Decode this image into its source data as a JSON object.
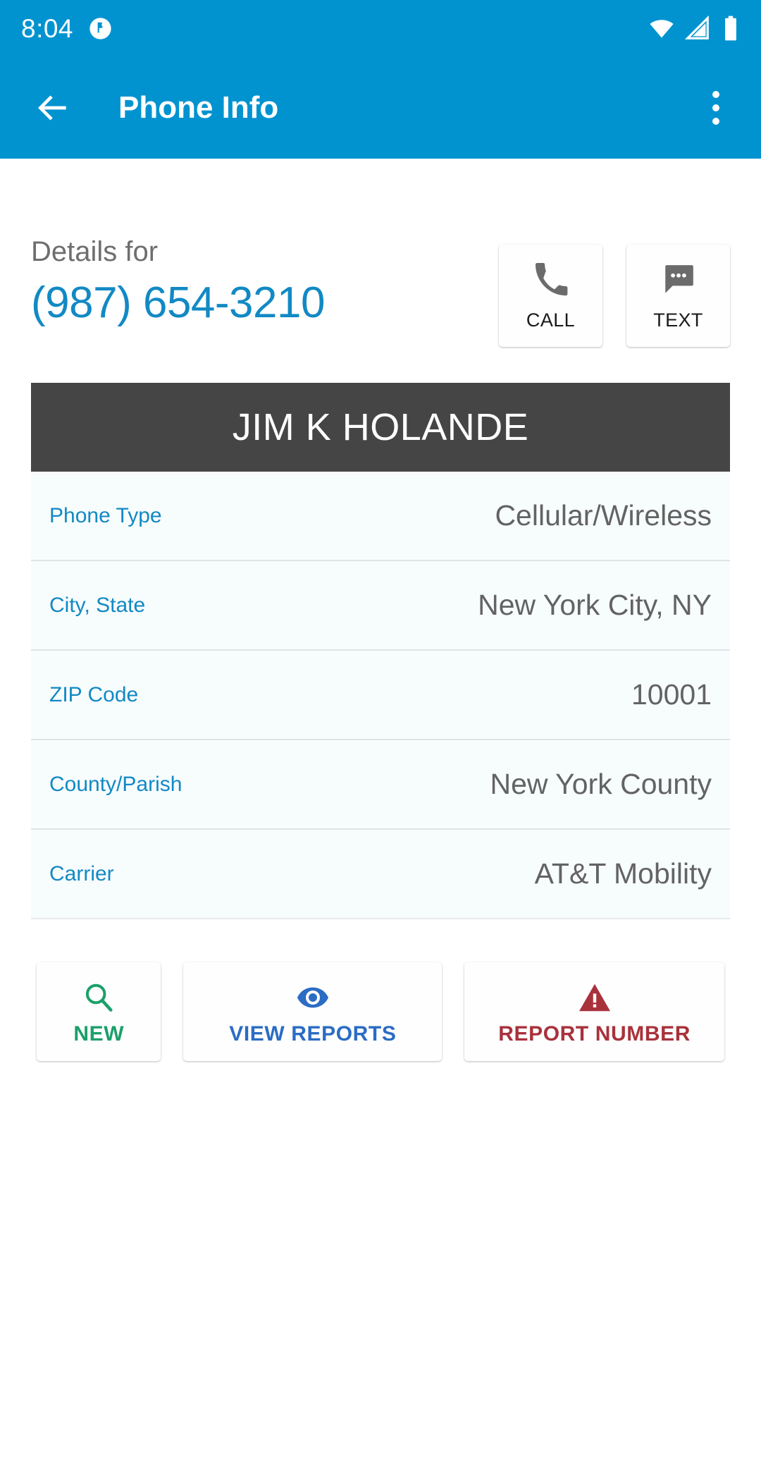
{
  "status_bar": {
    "time": "8:04",
    "notification_icon": "app-notification-icon",
    "wifi_icon": "wifi-icon",
    "signal_icon": "cellular-signal-icon",
    "battery_icon": "battery-full-icon",
    "background_color": "#0093D0"
  },
  "app_bar": {
    "back_icon": "back-arrow-icon",
    "title": "Phone Info",
    "overflow_icon": "overflow-menu-icon",
    "background_color": "#0093D0"
  },
  "details": {
    "label": "Details for",
    "phone_number": "(987) 654-3210",
    "phone_number_color": "#1289C4",
    "actions": [
      {
        "label": "CALL",
        "icon": "phone-icon"
      },
      {
        "label": "TEXT",
        "icon": "message-bubble-icon"
      }
    ]
  },
  "record": {
    "name": "JIM K HOLANDE",
    "banner_color": "#454545",
    "rows": [
      {
        "label": "Phone Type",
        "value": "Cellular/Wireless"
      },
      {
        "label": "City, State",
        "value": "New York City, NY"
      },
      {
        "label": "ZIP Code",
        "value": "10001"
      },
      {
        "label": "County/Parish",
        "value": "New York County"
      },
      {
        "label": "Carrier",
        "value": "AT&T Mobility"
      }
    ],
    "label_color": "#1289C4",
    "value_color": "#636363"
  },
  "bottom_actions": [
    {
      "label": "NEW",
      "icon": "search-icon",
      "color": "#1CA06B"
    },
    {
      "label": "VIEW REPORTS",
      "icon": "eye-icon",
      "color": "#2B6CC4"
    },
    {
      "label": "REPORT NUMBER",
      "icon": "warning-triangle-icon",
      "color": "#A8323C"
    }
  ]
}
